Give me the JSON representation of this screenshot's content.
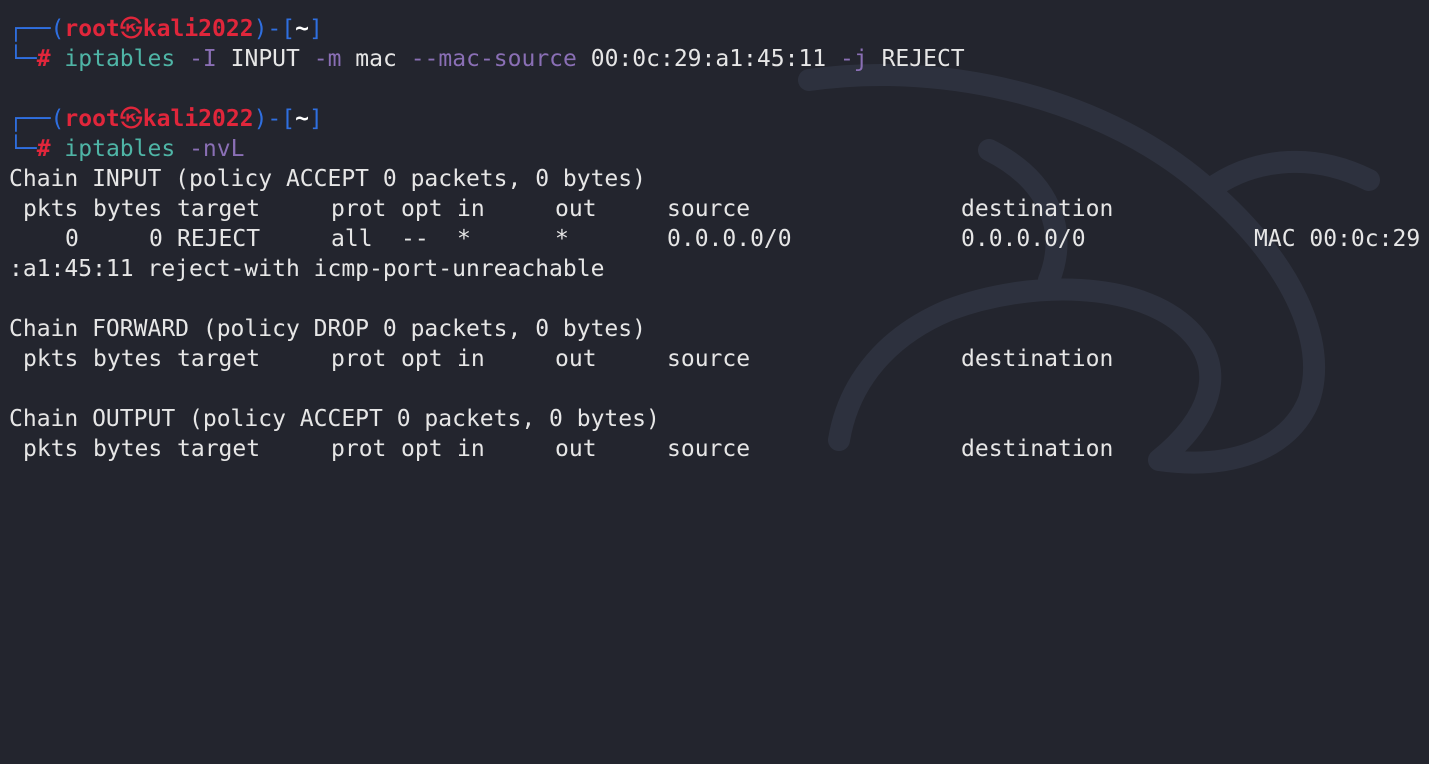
{
  "colors": {
    "background": "#23252e",
    "prompt_frame": "#2f6fe0",
    "prompt_user": "#e0263b",
    "command": "#4fb5a6",
    "flag": "#8a6fb5",
    "text": "#e6e6e6"
  },
  "prompt": {
    "top_left": "┌──(",
    "user": "root",
    "at_symbol": "㉿",
    "host": "kali2022",
    "mid": ")-[",
    "dir": "~",
    "close": "]",
    "bottom_left": "└─",
    "hash": "#"
  },
  "command1": {
    "program": "iptables",
    "tokens": [
      {
        "kind": "flag",
        "text": "-I"
      },
      {
        "kind": "arg",
        "text": "INPUT"
      },
      {
        "kind": "flag",
        "text": "-m"
      },
      {
        "kind": "arg",
        "text": "mac"
      },
      {
        "kind": "flag",
        "text": "--mac-source"
      },
      {
        "kind": "arg",
        "text": "00:0c:29:a1:45:11"
      },
      {
        "kind": "flag",
        "text": "-j"
      },
      {
        "kind": "arg",
        "text": "REJECT"
      }
    ]
  },
  "command2": {
    "program": "iptables",
    "flag": "-nvL"
  },
  "output": {
    "chain_input": {
      "title": "Chain INPUT (policy ACCEPT 0 packets, 0 bytes)",
      "headers": [
        "pkts",
        "bytes",
        "target",
        "prot",
        "opt",
        "in",
        "out",
        "source",
        "destination"
      ],
      "rule": {
        "pkts": "0",
        "bytes": "0",
        "target": "REJECT",
        "prot": "all",
        "opt": "--",
        "in": "*",
        "out": "*",
        "source": "0.0.0.0/0",
        "destination": "0.0.0.0/0",
        "extra": "MAC 00:0c:29",
        "wrap": ":a1:45:11 reject-with icmp-port-unreachable"
      }
    },
    "chain_forward": {
      "title": "Chain FORWARD (policy DROP 0 packets, 0 bytes)",
      "headers": [
        "pkts",
        "bytes",
        "target",
        "prot",
        "opt",
        "in",
        "out",
        "source",
        "destination"
      ]
    },
    "chain_output": {
      "title": "Chain OUTPUT (policy ACCEPT 0 packets, 0 bytes)",
      "headers": [
        "pkts",
        "bytes",
        "target",
        "prot",
        "opt",
        "in",
        "out",
        "source",
        "destination"
      ]
    }
  }
}
